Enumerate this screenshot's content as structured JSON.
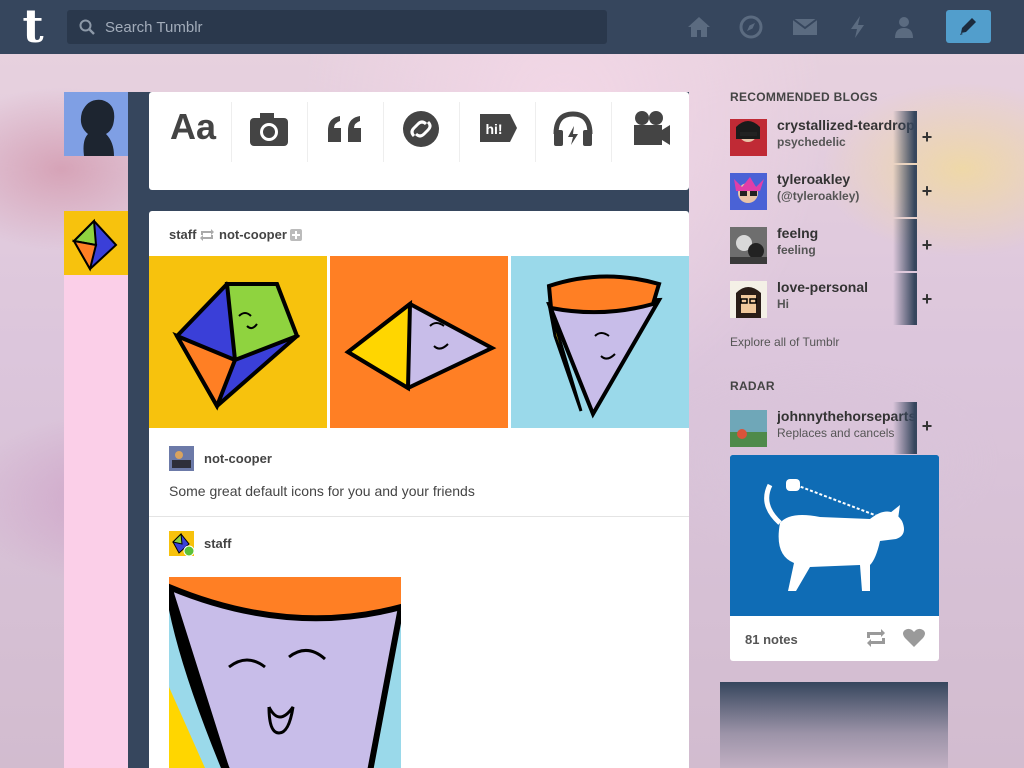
{
  "header": {
    "logo": "t",
    "search_placeholder": "Search Tumblr",
    "nav_icons": [
      "home-icon",
      "explore-compass-icon",
      "inbox-mail-icon",
      "activity-lightning-icon",
      "account-person-icon"
    ],
    "compose_icon": "pencil-icon"
  },
  "post_types": [
    {
      "label": "Aa",
      "icon": "text-icon"
    },
    {
      "icon": "camera-icon"
    },
    {
      "icon": "quote-icon"
    },
    {
      "icon": "link-icon"
    },
    {
      "label": "hi!",
      "icon": "chat-icon"
    },
    {
      "icon": "audio-headphones-icon"
    },
    {
      "icon": "video-camera-icon"
    }
  ],
  "post": {
    "rebloged_by": "staff",
    "original_author": "not-cooper",
    "reblog_author": "not-cooper",
    "caption": "Some great default icons for you and your friends",
    "commenter": "staff",
    "colors": {
      "tile1": "#f7c20d",
      "tile2": "#ff7f24",
      "tile3": "#9ad9ea"
    }
  },
  "sidebar": {
    "recommended_title": "RECOMMENDED BLOGS",
    "recommended": [
      {
        "name": "crystallized-teardrop",
        "subtitle": "psychedelic"
      },
      {
        "name": "tyleroakley",
        "subtitle": "(@tyleroakley)"
      },
      {
        "name": "feelng",
        "subtitle": "feeling"
      },
      {
        "name": "love-personal",
        "subtitle": "Hi"
      }
    ],
    "explore": "Explore all of Tumblr",
    "radar_title": "RADAR",
    "radar": {
      "name": "johnnythehorseparts",
      "subtitle": "Replaces and cancels",
      "notes": "81 notes"
    }
  }
}
